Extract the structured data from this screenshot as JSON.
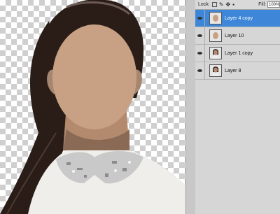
{
  "lock_bar": {
    "lock_label": "Lock:",
    "fill_label": "Fill:",
    "fill_value": "100%"
  },
  "layers": [
    {
      "name": "Layer 4 copy",
      "selected": true,
      "thumb": "face-mask-icon"
    },
    {
      "name": "Layer 10",
      "selected": false,
      "thumb": "face-mask-icon"
    },
    {
      "name": "Layer 1 copy",
      "selected": false,
      "thumb": "portrait-icon"
    },
    {
      "name": "Layer 8",
      "selected": false,
      "thumb": "portrait-icon"
    }
  ],
  "colors": {
    "selection": "#3d86d8",
    "skin": "#c8a184",
    "hair": "#2a1d17"
  }
}
